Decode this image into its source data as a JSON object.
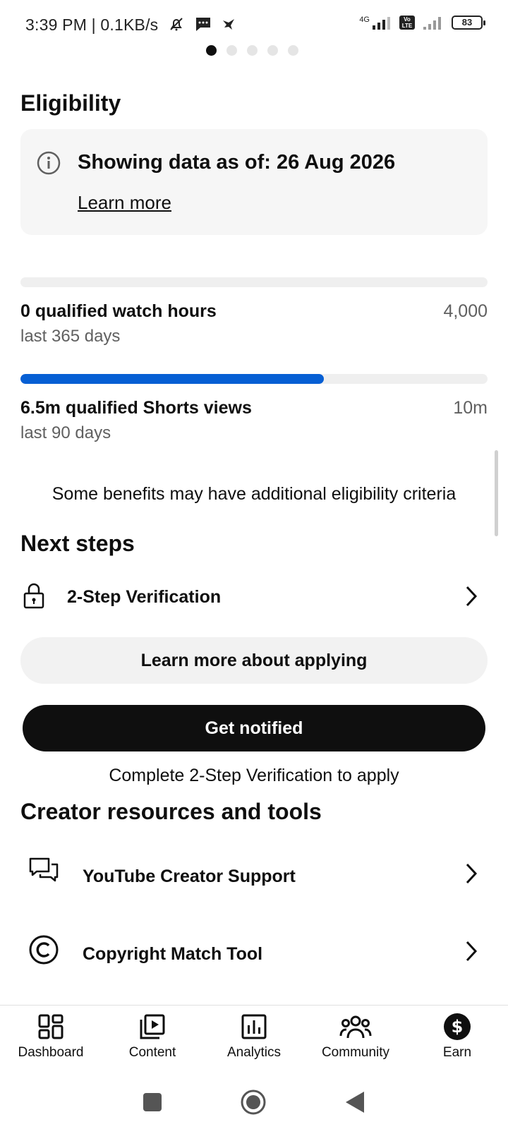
{
  "status_bar": {
    "time_speed": "3:39 PM | 0.1KB/s",
    "network_label": "4G",
    "volte_label": "Vo LTE",
    "battery": "83"
  },
  "pagination": {
    "count": 5,
    "active": 0
  },
  "eligibility": {
    "title": "Eligibility",
    "info_text": "Showing data as of: 26 Aug 2026",
    "learn_more": "Learn more"
  },
  "metrics": [
    {
      "label": "0 qualified watch hours",
      "period": "last 365 days",
      "target": "4,000",
      "progress": 0.0
    },
    {
      "label": "6.5m qualified Shorts views",
      "period": "last 90 days",
      "target": "10m",
      "progress": 0.65
    }
  ],
  "note": "Some benefits may have additional eligibility criteria",
  "next_steps": {
    "title": "Next steps",
    "items": [
      {
        "label": "2-Step Verification",
        "icon": "lock-icon"
      }
    ],
    "learn_more_button": "Learn more about applying",
    "get_notified_button": "Get notified",
    "helper_text": "Complete 2-Step Verification to apply"
  },
  "resources": {
    "title": "Creator resources and tools",
    "items": [
      {
        "label": "YouTube Creator Support",
        "icon": "chat-bubbles-icon"
      },
      {
        "label": "Copyright Match Tool",
        "icon": "copyright-icon"
      }
    ]
  },
  "bottom_nav": {
    "active": "Earn",
    "items": [
      {
        "label": "Dashboard",
        "icon": "dashboard-icon"
      },
      {
        "label": "Content",
        "icon": "content-icon"
      },
      {
        "label": "Analytics",
        "icon": "analytics-icon"
      },
      {
        "label": "Community",
        "icon": "community-icon"
      },
      {
        "label": "Earn",
        "icon": "earn-dollar-icon"
      }
    ]
  },
  "colors": {
    "accent": "#065fd4",
    "primary_button": "#0f0f0f",
    "secondary_button": "#f2f2f2",
    "card_bg": "#f6f6f6"
  }
}
